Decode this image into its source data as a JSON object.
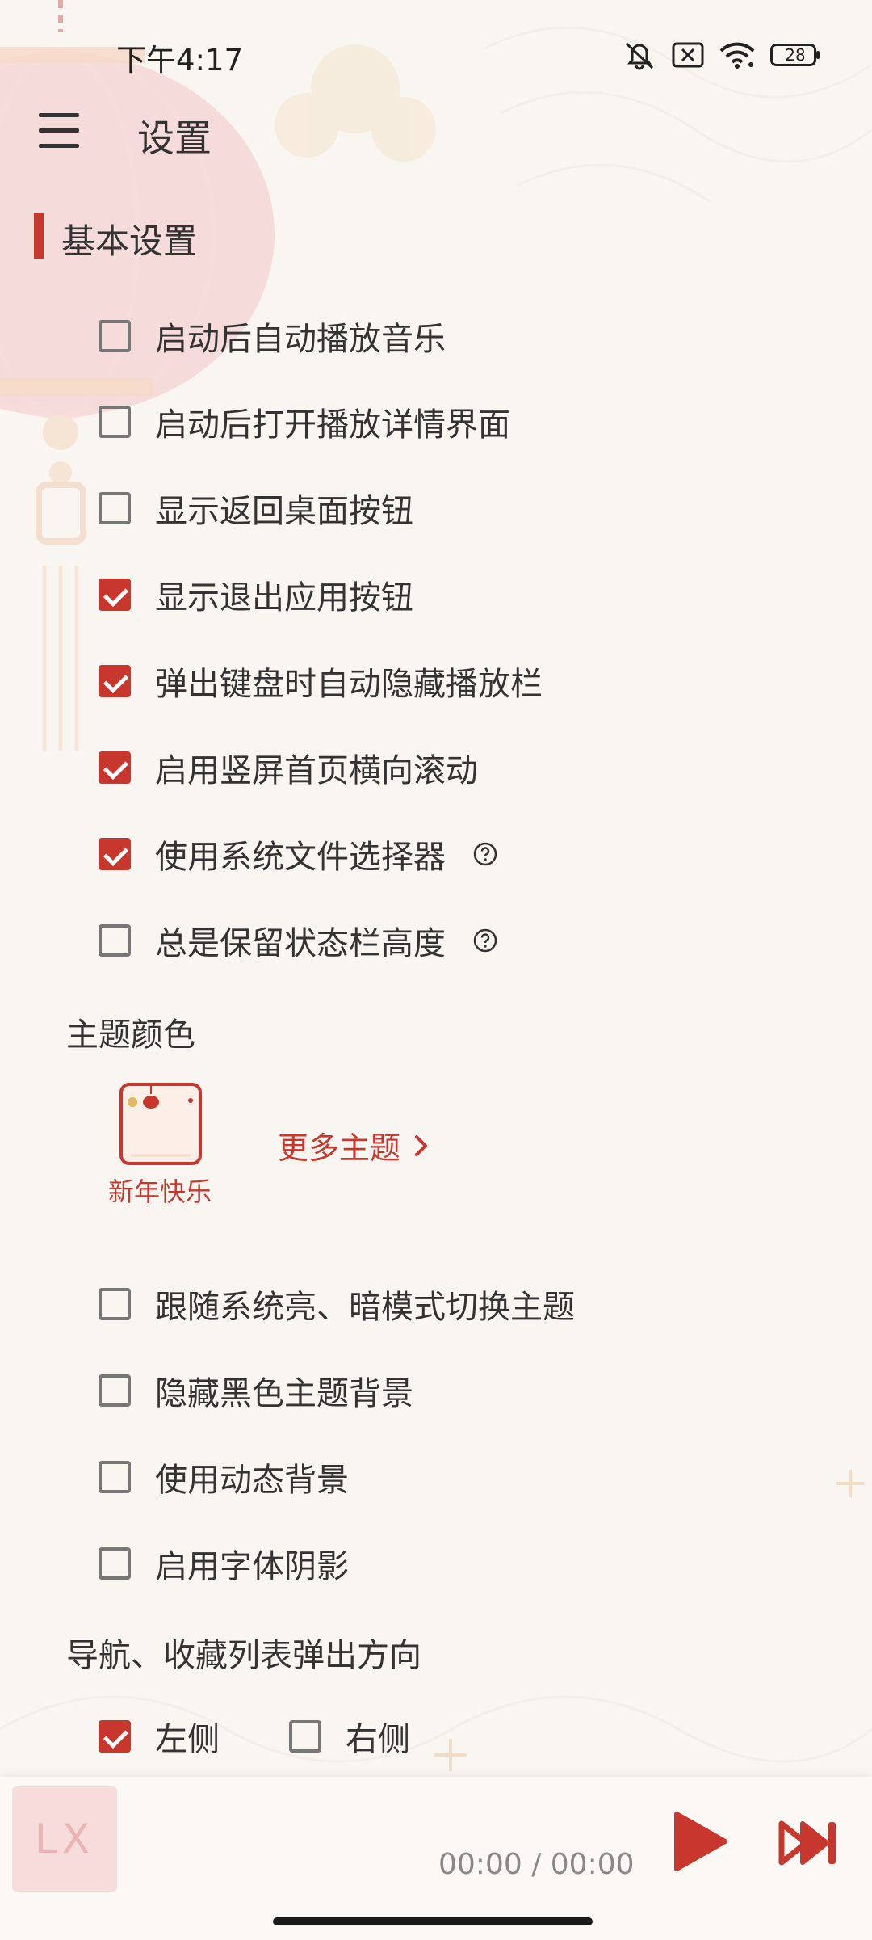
{
  "status": {
    "time": "下午4:17",
    "battery": "28"
  },
  "header": {
    "title": "设置"
  },
  "section": {
    "title": "基本设置"
  },
  "basic_options": [
    {
      "label": "启动后自动播放音乐",
      "checked": false
    },
    {
      "label": "启动后打开播放详情界面",
      "checked": false
    },
    {
      "label": "显示返回桌面按钮",
      "checked": false
    },
    {
      "label": "显示退出应用按钮",
      "checked": true
    },
    {
      "label": "弹出键盘时自动隐藏播放栏",
      "checked": true
    },
    {
      "label": "启用竖屏首页横向滚动",
      "checked": true
    },
    {
      "label": "使用系统文件选择器",
      "checked": true
    },
    {
      "label": "总是保留状态栏高度",
      "checked": false
    }
  ],
  "theme": {
    "title": "主题颜色",
    "current": "新年快乐",
    "more": "更多主题"
  },
  "theme_options": [
    {
      "label": "跟随系统亮、暗模式切换主题",
      "checked": false
    },
    {
      "label": "隐藏黑色主题背景",
      "checked": false
    },
    {
      "label": "使用动态背景",
      "checked": false
    },
    {
      "label": "启用字体阴影",
      "checked": false
    }
  ],
  "direction": {
    "title": "导航、收藏列表弹出方向",
    "left": {
      "label": "左侧",
      "checked": true
    },
    "right": {
      "label": "右侧",
      "checked": false
    }
  },
  "player": {
    "cover_text": "LX",
    "time": "00:00 / 00:00"
  },
  "colors": {
    "accent": "#c8372d",
    "background": "#f9f5f1"
  }
}
